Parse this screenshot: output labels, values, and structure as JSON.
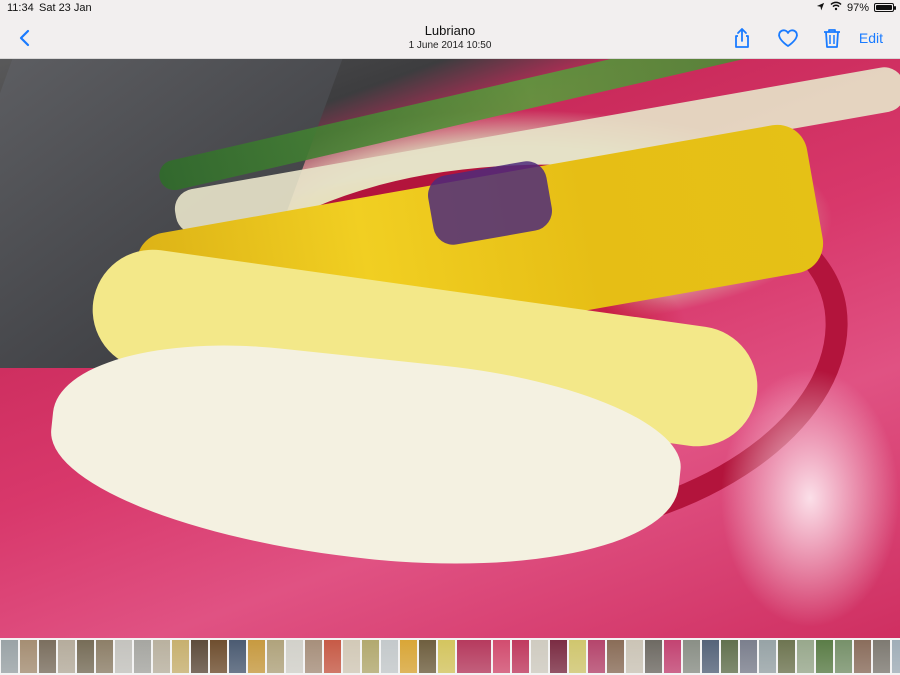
{
  "status": {
    "time": "11:34",
    "date": "Sat 23 Jan",
    "battery": "97%"
  },
  "header": {
    "title": "Lubriano",
    "subtitle": "1 June 2014  10:50",
    "edit_label": "Edit"
  },
  "colors": {
    "accent": "#1a7bff",
    "topbar": "#f2efef"
  },
  "icons": {
    "back": "chevron-left-icon",
    "share": "share-icon",
    "favorite": "heart-icon",
    "delete": "trash-icon",
    "wifi": "wifi-icon",
    "battery": "battery-icon",
    "location": "location-icon"
  },
  "thumbnails": [
    "#9aa3a6",
    "#a58e73",
    "#7b6f5f",
    "#b5ac9c",
    "#776d58",
    "#8d7f68",
    "#c4c3be",
    "#a6a6a1",
    "#b9b19f",
    "#c7b06f",
    "#5e4c3c",
    "#6f4e2f",
    "#4b5b72",
    "#c79a40",
    "#b0a37c",
    "#d2d1ca",
    "#a78f7b",
    "#c75a46",
    "#d2c9b7",
    "#b2a96f",
    "#c4c9cb",
    "#d9a637",
    "#6f5f3f",
    "#d4c55f",
    "#b63a5e",
    "#d24c6f",
    "#c03a5f",
    "#cfcbc0",
    "#7b2c43",
    "#d0c66e",
    "#b5456c",
    "#8a6d58",
    "#cbc4b6",
    "#6e6a63",
    "#c34372",
    "#8a8f86",
    "#55647a",
    "#62714e",
    "#7b7f8d",
    "#97a3a6",
    "#6e7551",
    "#98a88c",
    "#5b7d47",
    "#77916a",
    "#8a6d5c",
    "#7e7a72",
    "#a0aeb8",
    "#6c7f84",
    "#6f8f5c",
    "#8cb06b",
    "#a6c3d4",
    "#6d8c4d",
    "#8eb5d8",
    "#4f7a3f"
  ],
  "active_thumbnail_index": 24
}
